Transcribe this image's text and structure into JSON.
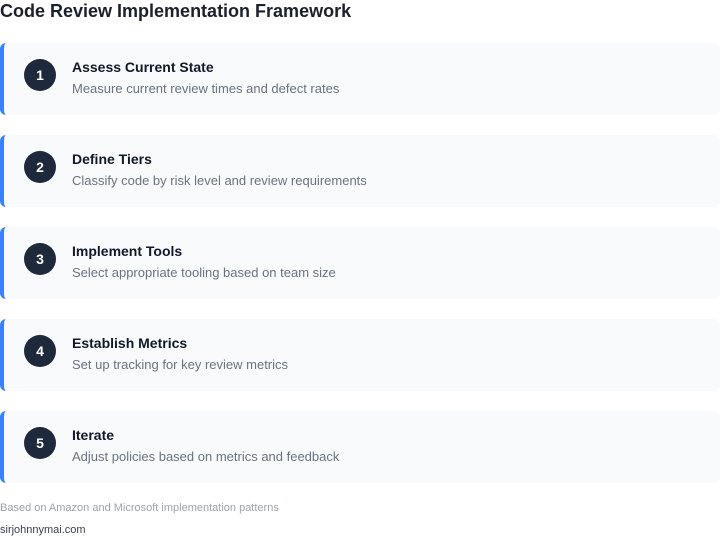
{
  "title": "Code Review Implementation Framework",
  "steps": [
    {
      "number": "1",
      "title": "Assess Current State",
      "description": "Measure current review times and defect rates"
    },
    {
      "number": "2",
      "title": "Define Tiers",
      "description": "Classify code by risk level and review requirements"
    },
    {
      "number": "3",
      "title": "Implement Tools",
      "description": "Select appropriate tooling based on team size"
    },
    {
      "number": "4",
      "title": "Establish Metrics",
      "description": "Set up tracking for key review metrics"
    },
    {
      "number": "5",
      "title": "Iterate",
      "description": "Adjust policies based on metrics and feedback"
    }
  ],
  "footnote": "Based on Amazon and Microsoft implementation patterns",
  "site": "sirjohnnymai.com",
  "colors": {
    "accent": "#3b82f6",
    "badge": "#1e293b",
    "card_bg": "#f8fafc"
  }
}
